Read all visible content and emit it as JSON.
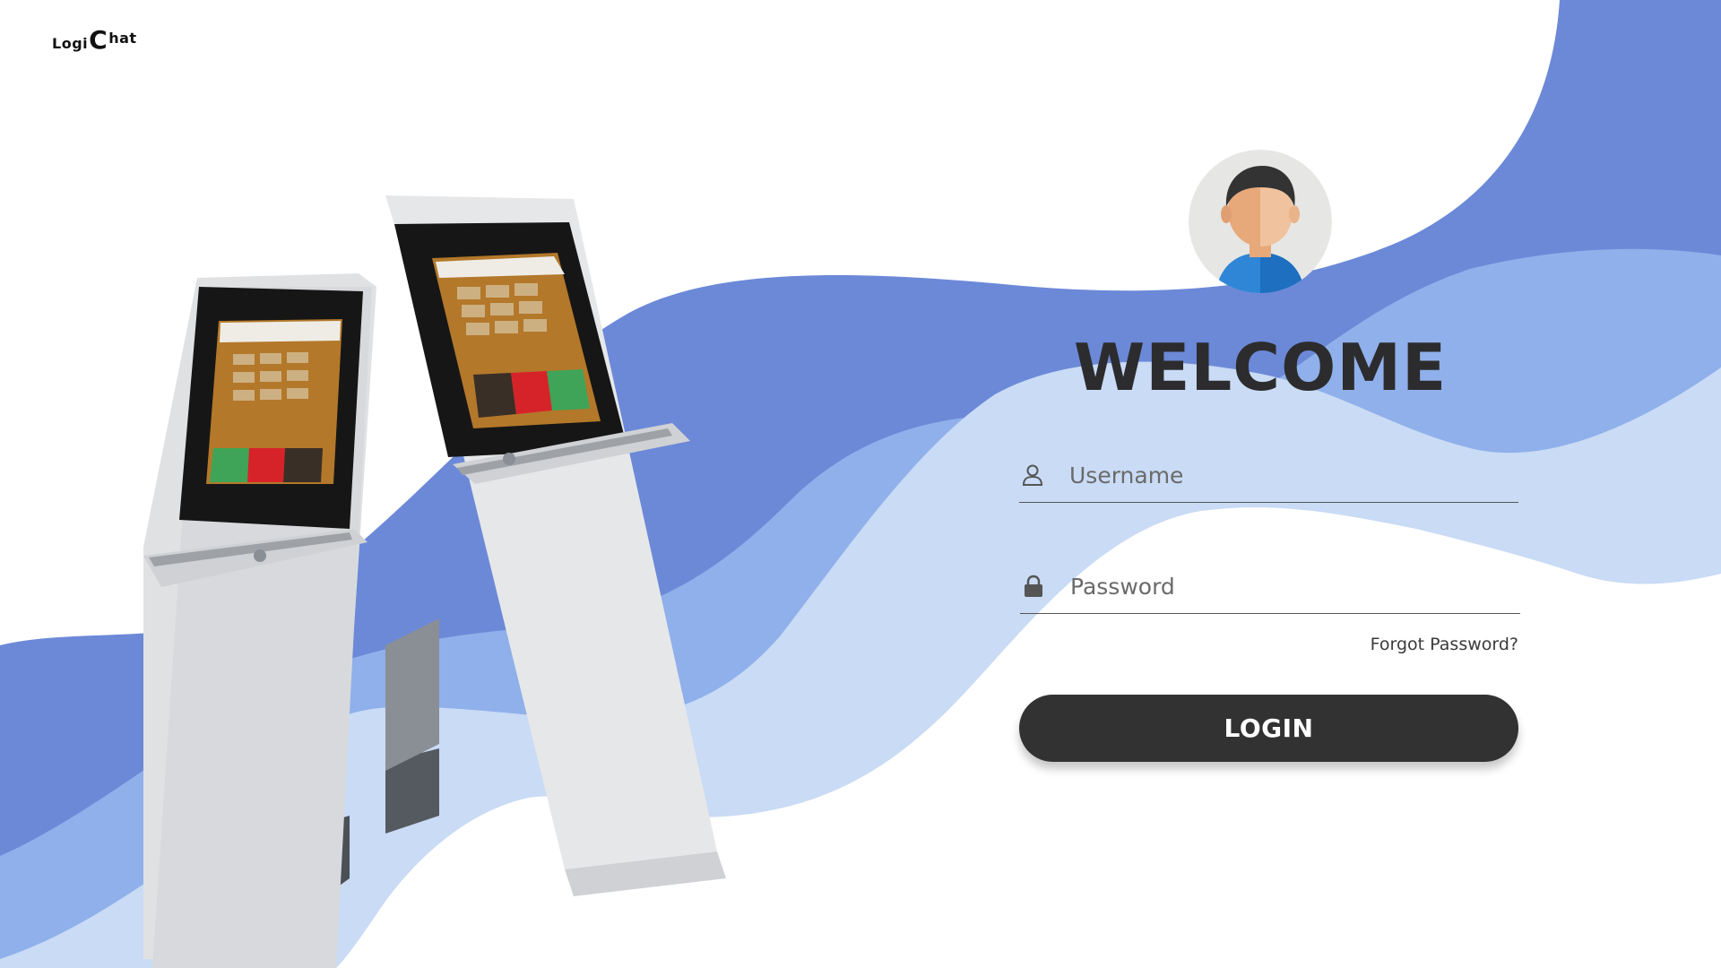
{
  "app": {
    "logo_part1": "Logi",
    "logo_part2": "C",
    "logo_part3": "hat"
  },
  "login": {
    "heading": "WELCOME",
    "username_placeholder": "Username",
    "password_placeholder": "Password",
    "forgot_label": "Forgot Password?",
    "submit_label": "LOGIN"
  },
  "colors": {
    "wave_dark": "#6c89d8",
    "wave_mid": "#8fb0ea",
    "wave_light": "#c9dbf5",
    "button_bg": "#323232",
    "heading": "#2c2c2e"
  },
  "icons": {
    "username": "user-icon",
    "password": "lock-icon"
  }
}
